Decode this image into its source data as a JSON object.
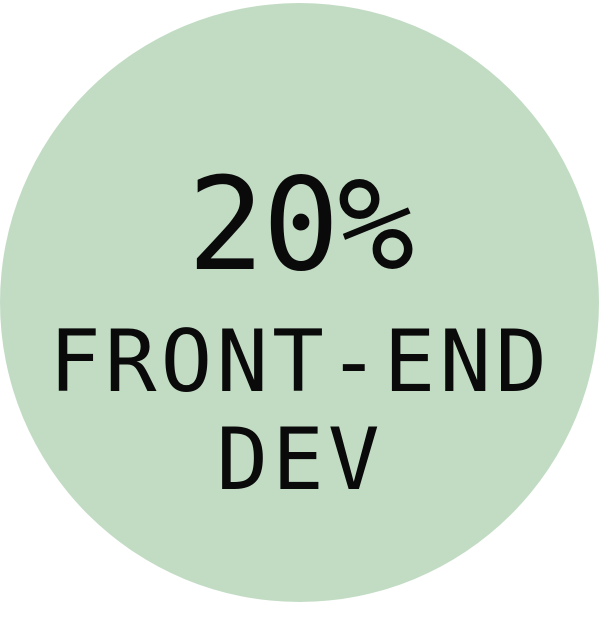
{
  "badge": {
    "percentage": "20%",
    "label_line_1": "FRONT-END",
    "label_line_2": "DEV",
    "circle_color": "#c2dcc4",
    "text_color": "#0a0a0a"
  }
}
